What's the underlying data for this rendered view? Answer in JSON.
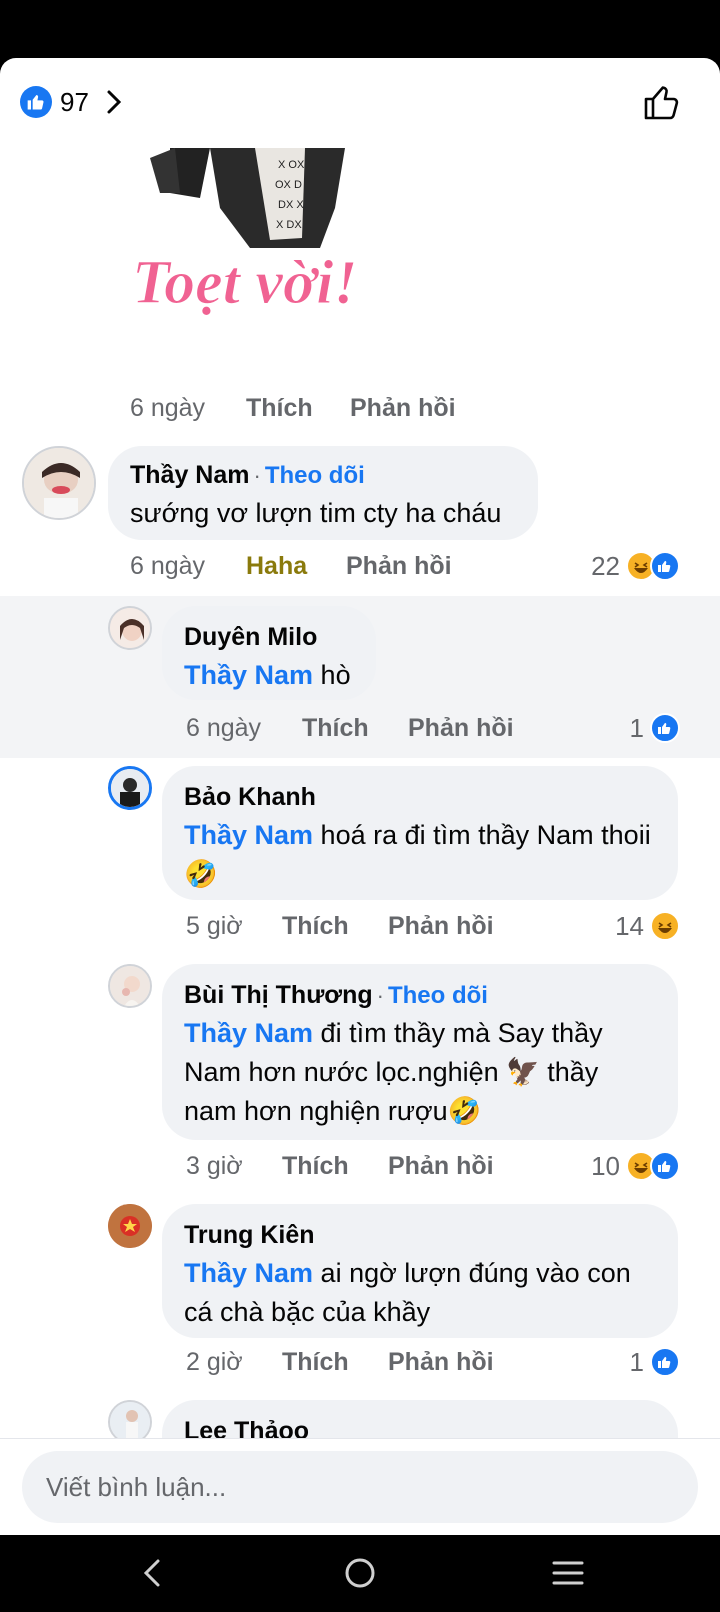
{
  "header": {
    "like_count": "97"
  },
  "sticker": {
    "text": "Toẹt vời!"
  },
  "first_meta": {
    "time": "6 ngày",
    "like": "Thích",
    "reply": "Phản hồi"
  },
  "comments": [
    {
      "author": "Thầy Nam",
      "follow": "Theo dõi",
      "text": "sướng vơ lượn tim cty ha cháu",
      "time": "6 ngày",
      "like": "Haha",
      "reply": "Phản hồi",
      "reaction_count": "22",
      "reactions": [
        "haha-icon",
        "like-icon"
      ]
    },
    {
      "author": "Duyên Milo",
      "mention": "Thầy Nam",
      "text": " hò",
      "time": "6 ngày",
      "like": "Thích",
      "reply": "Phản hồi",
      "reaction_count": "1",
      "reactions": [
        "like-icon"
      ]
    },
    {
      "author": "Bảo Khanh",
      "mention": "Thầy Nam",
      "text": " hoá ra đi tìm thầy Nam thoii🤣",
      "time": "5 giờ",
      "like": "Thích",
      "reply": "Phản hồi",
      "reaction_count": "14",
      "reactions": [
        "haha-icon"
      ]
    },
    {
      "author": "Bùi Thị Thương",
      "follow": "Theo dõi",
      "mention": "Thầy Nam",
      "text": " đi tìm thầy mà Say thầy Nam hơn nước lọc.nghiện 🦅 thầy nam hơn nghiện rượu🤣",
      "time": "3 giờ",
      "like": "Thích",
      "reply": "Phản hồi",
      "reaction_count": "10",
      "reactions": [
        "haha-icon",
        "like-icon"
      ]
    },
    {
      "author": "Trung Kiên",
      "mention": "Thầy Nam",
      "text": " ai ngờ lượn đúng vào con cá chà bặc của khầy",
      "time": "2 giờ",
      "like": "Thích",
      "reply": "Phản hồi",
      "reaction_count": "1",
      "reactions": [
        "like-icon"
      ]
    },
    {
      "author": "Lee Thảoo"
    }
  ],
  "composer": {
    "placeholder": "Viết bình luận..."
  },
  "colors": {
    "accent": "#1877f2",
    "bubble": "#f0f2f5",
    "muted": "#65676b",
    "haha_label": "#8a7a0c"
  }
}
